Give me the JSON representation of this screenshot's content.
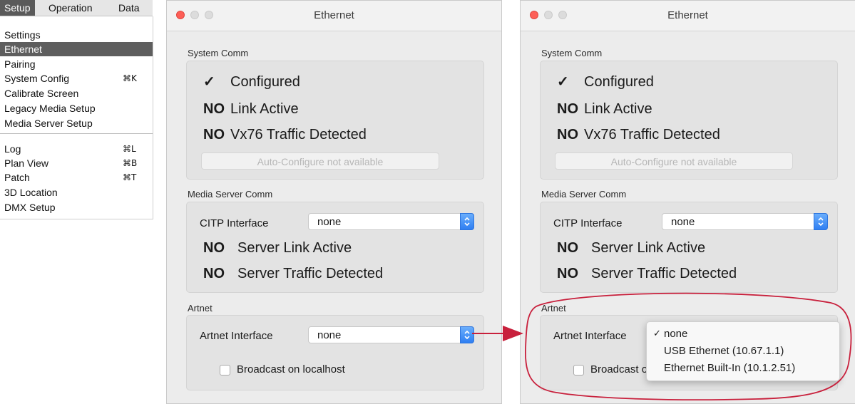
{
  "menu": {
    "menubar": [
      "Setup",
      "Operation",
      "Data"
    ],
    "items": [
      {
        "label": "Settings",
        "shortcut": ""
      },
      {
        "label": "Ethernet",
        "shortcut": ""
      },
      {
        "label": "Pairing",
        "shortcut": ""
      },
      {
        "label": "System Config",
        "shortcut": "⌘K"
      },
      {
        "label": "Calibrate Screen",
        "shortcut": ""
      },
      {
        "label": "Legacy Media Setup",
        "shortcut": ""
      },
      {
        "label": "Media Server Setup",
        "shortcut": ""
      },
      {
        "label": "Log",
        "shortcut": "⌘L"
      },
      {
        "label": "Plan View",
        "shortcut": "⌘B"
      },
      {
        "label": "Patch",
        "shortcut": "⌘T"
      },
      {
        "label": "3D Location",
        "shortcut": ""
      },
      {
        "label": "DMX Setup",
        "shortcut": ""
      }
    ]
  },
  "window": {
    "title": "Ethernet",
    "system_comm": {
      "heading": "System Comm",
      "configured_mark": "✓",
      "configured_label": "Configured",
      "link_mark": "NO",
      "link_label": "Link Active",
      "traffic_mark": "NO",
      "traffic_label": "Vx76 Traffic Detected",
      "auto_configure_button": "Auto-Configure not available"
    },
    "media_server_comm": {
      "heading": "Media Server Comm",
      "citp_label": "CITP Interface",
      "citp_value": "none",
      "server_link_mark": "NO",
      "server_link_label": "Server Link Active",
      "server_traffic_mark": "NO",
      "server_traffic_label": "Server Traffic Detected"
    },
    "artnet": {
      "heading": "Artnet",
      "interface_label": "Artnet Interface",
      "interface_value": "none",
      "broadcast_label": "Broadcast on localhost",
      "broadcast_label_truncated": "Broadcast o"
    }
  },
  "artnet_popup": {
    "checkmark": "✓",
    "options": [
      "none",
      "USB Ethernet (10.67.1.1)",
      "Ethernet Built-In (10.1.2.51)"
    ],
    "selected": "none"
  },
  "colors": {
    "menu_highlight": "#5e5e5e",
    "callout_red": "#c8203c",
    "stepper_blue": "#2f7ff2",
    "close_red": "#fd5f57"
  }
}
